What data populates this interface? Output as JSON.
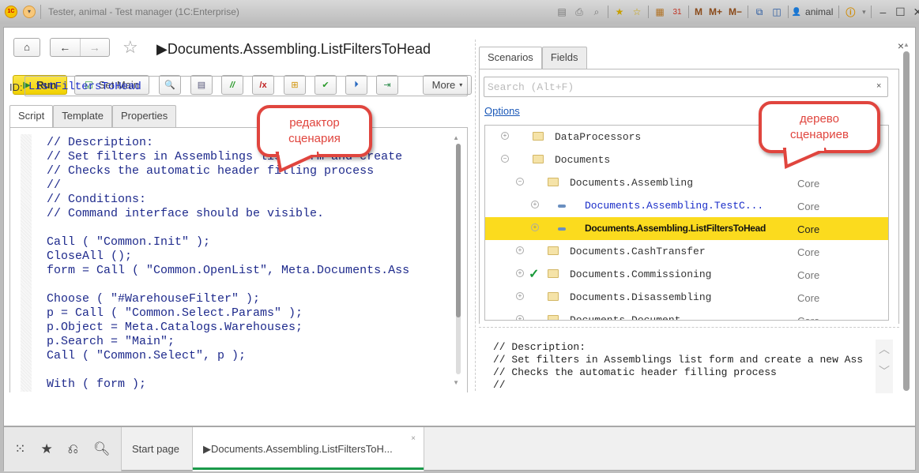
{
  "titlebar": {
    "title": "Tester, animal  - Test manager (1C:Enterprise)",
    "logo": "1C",
    "user": "animal",
    "m_buttons": [
      "M",
      "M+",
      "M−"
    ],
    "calendar_day": "31"
  },
  "header": {
    "title": "▶Documents.Assembling.ListFiltersToHead",
    "home_icon": "⌂",
    "back_icon": "←",
    "forward_icon": "→",
    "star_icon": "☆",
    "close_icon": "×"
  },
  "toolbar": {
    "run_label": "Run",
    "set_main_label": "Set Main",
    "more_label": "More"
  },
  "id_field": {
    "label": "ID:",
    "value": "ListFiltersToHead"
  },
  "left_tabs": [
    "Script",
    "Template",
    "Properties"
  ],
  "script_lines": [
    "// Description:",
    "// Set filters in Assemblings list form and create",
    "// Checks the automatic header filling process",
    "//",
    "// Conditions:",
    "// Command interface should be visible.",
    "",
    "Call ( \"Common.Init\" );",
    "CloseAll ();",
    "form = Call ( \"Common.OpenList\", Meta.Documents.Ass",
    "",
    "Choose ( \"#WarehouseFilter\" );",
    "p = Call ( \"Common.Select.Params\" );",
    "p.Object = Meta.Catalogs.Warehouses;",
    "p.Search = \"Main\";",
    "Call ( \"Common.Select\", p );",
    "",
    "With ( form );"
  ],
  "right_tabs": [
    "Scenarios",
    "Fields"
  ],
  "search": {
    "placeholder": "Search (Alt+F)",
    "clear": "×"
  },
  "options_link": "Options",
  "tree": [
    {
      "name": "DataProcessors",
      "level": 0,
      "expander": "⊕",
      "type": "folder",
      "tag": ""
    },
    {
      "name": "Documents",
      "level": 0,
      "expander": "⊖",
      "type": "folder",
      "tag": ""
    },
    {
      "name": "Documents.Assembling",
      "level": 1,
      "expander": "⊖",
      "type": "folder",
      "tag": "Core"
    },
    {
      "name": "Documents.Assembling.TestC...",
      "level": 2,
      "expander": "⊕",
      "type": "scenario",
      "tag": "Core"
    },
    {
      "name": "Documents.Assembling.ListFiltersToHead",
      "level": 2,
      "expander": "⊕",
      "type": "scenario",
      "tag": "Core",
      "selected": true
    },
    {
      "name": "Documents.CashTransfer",
      "level": 1,
      "expander": "⊕",
      "type": "folder",
      "tag": "Core"
    },
    {
      "name": "Documents.Commissioning",
      "level": 1,
      "expander": "⊕",
      "type": "folder",
      "tag": "Core",
      "checked": true
    },
    {
      "name": "Documents.Disassembling",
      "level": 1,
      "expander": "⊕",
      "type": "folder",
      "tag": "Core"
    },
    {
      "name": "Documents.Document",
      "level": 1,
      "expander": "⊕",
      "type": "folder",
      "tag": "Core"
    }
  ],
  "preview_lines": [
    "// Description:",
    "// Set filters in Assemblings list form and create a new Ass",
    "// Checks the automatic header filling process",
    "//"
  ],
  "callouts": {
    "editor": "редактор\nсценария",
    "tree": "дерево\nсценариев"
  },
  "taskbar": {
    "tabs": [
      "Start page",
      "▶Documents.Assembling.ListFiltersToH..."
    ],
    "close": "×"
  },
  "colors": {
    "accent_green": "#1a9a4a",
    "selection_yellow": "#fbdb1e",
    "callout_red": "#e0453e"
  }
}
